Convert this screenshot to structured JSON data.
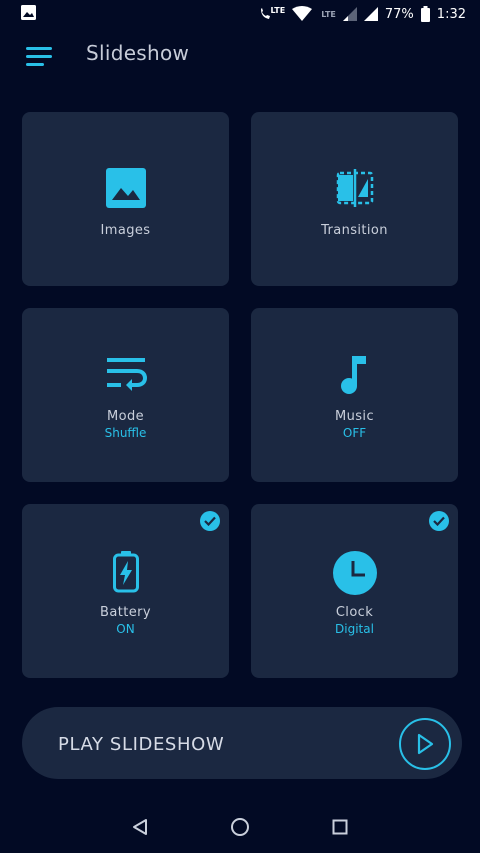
{
  "status_bar": {
    "lte_label": "LTE",
    "lte_secondary": "LTE",
    "battery_percent": "77%",
    "time": "1:32"
  },
  "app_bar": {
    "title": "Slideshow"
  },
  "cards": {
    "images": {
      "label": "Images",
      "icon": "image-icon"
    },
    "transition": {
      "label": "Transition",
      "icon": "flip-icon"
    },
    "mode": {
      "label": "Mode",
      "value": "Shuffle",
      "icon": "wrap-text-icon"
    },
    "music": {
      "label": "Music",
      "value": "OFF",
      "icon": "music-note-icon"
    },
    "battery": {
      "label": "Battery",
      "value": "ON",
      "icon": "battery-charging-icon",
      "checked": true
    },
    "clock": {
      "label": "Clock",
      "value": "Digital",
      "icon": "clock-icon",
      "checked": true
    }
  },
  "play": {
    "label": "PLAY SLIDESHOW"
  },
  "colors": {
    "background": "#020a24",
    "card": "#1b2841",
    "accent": "#29c0e8"
  }
}
